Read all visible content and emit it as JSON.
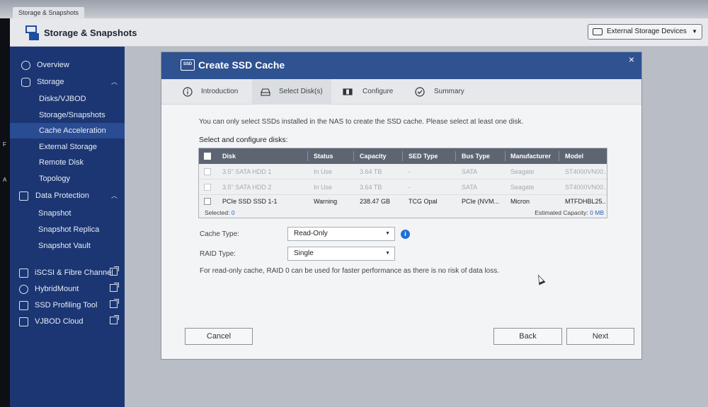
{
  "window": {
    "tab_label": "Storage & Snapshots"
  },
  "header": {
    "app_title": "Storage & Snapshots",
    "external_storage_label": "External Storage Devices"
  },
  "left_fragments": [
    "F",
    "A"
  ],
  "sidebar": {
    "overview": "Overview",
    "storage": "Storage",
    "storage_items": [
      "Disks/VJBOD",
      "Storage/Snapshots",
      "Cache Acceleration",
      "External Storage",
      "Remote Disk",
      "Topology"
    ],
    "data_protection": "Data Protection",
    "data_protection_items": [
      "Snapshot",
      "Snapshot Replica",
      "Snapshot Vault"
    ],
    "tools": [
      "iSCSI & Fibre Channel",
      "HybridMount",
      "SSD Profiling Tool",
      "VJBOD Cloud"
    ]
  },
  "dialog": {
    "icon_text": "SSD",
    "title": "Create SSD Cache",
    "close": "×",
    "steps": [
      "Introduction",
      "Select Disk(s)",
      "Configure",
      "Summary"
    ],
    "instruction": "You can only select SSDs installed in the NAS to create the SSD cache. Please select at least one disk.",
    "section_label": "Select and configure disks:",
    "table": {
      "columns": [
        "Disk",
        "Status",
        "Capacity",
        "SED Type",
        "Bus Type",
        "Manufacturer",
        "Model"
      ],
      "rows": [
        {
          "disk": "3.5\" SATA HDD 1",
          "status": "In Use",
          "capacity": "3.64 TB",
          "sed": "-",
          "bus": "SATA",
          "manufacturer": "Seagate",
          "model": "ST4000VN00..."
        },
        {
          "disk": "3.5\" SATA HDD 2",
          "status": "In Use",
          "capacity": "3.64 TB",
          "sed": "-",
          "bus": "SATA",
          "manufacturer": "Seagate",
          "model": "ST4000VN00..."
        },
        {
          "disk": "PCIe SSD SSD 1-1",
          "status": "Warning",
          "capacity": "238.47 GB",
          "sed": "TCG Opal",
          "bus": "PCIe (NVM...",
          "manufacturer": "Micron",
          "model": "MTFDHBL25..."
        }
      ],
      "selected_label": "Selected:",
      "selected_count": "0",
      "estimated_label": "Estimated Capacity:",
      "estimated_value": "0 MB"
    },
    "cache_type_label": "Cache Type:",
    "cache_type_value": "Read-Only",
    "raid_type_label": "RAID Type:",
    "raid_type_value": "Single",
    "raid_note": "For read-only cache, RAID 0 can be used for faster performance as there is no risk of data loss.",
    "buttons": {
      "cancel": "Cancel",
      "back": "Back",
      "next": "Next"
    }
  },
  "colors": {
    "sidebar": "#1b3672",
    "dialog_header": "#2f5291",
    "link": "#2a61c9",
    "info": "#1f6fd6"
  }
}
